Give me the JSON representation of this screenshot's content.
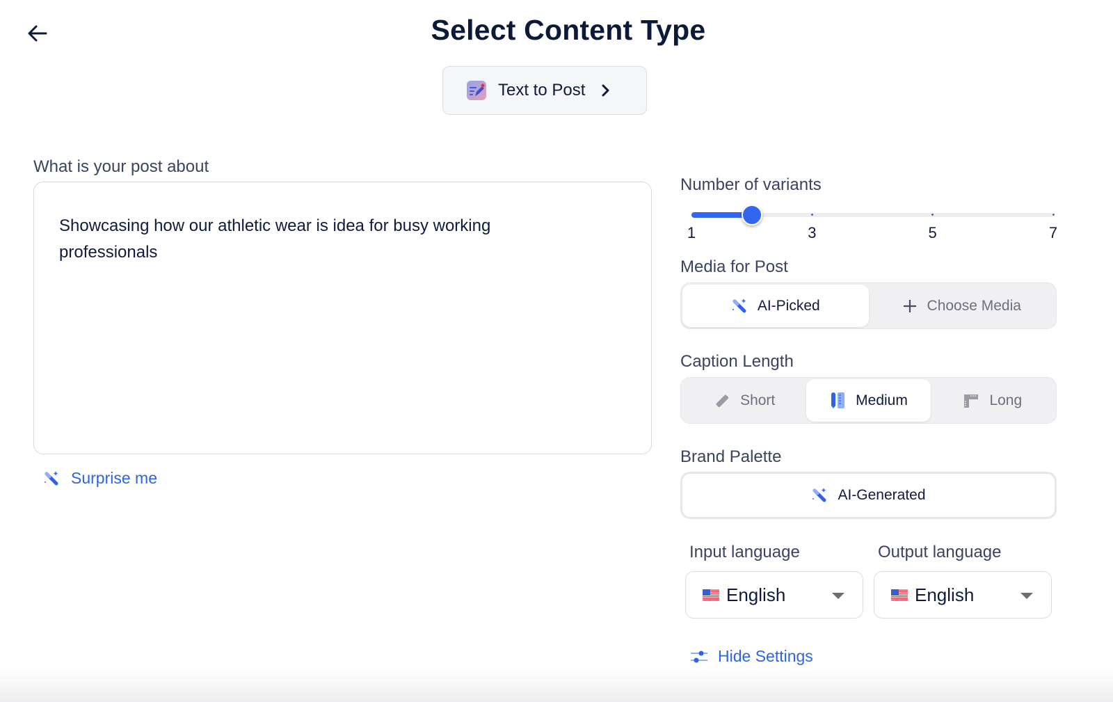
{
  "header": {
    "title": "Select Content Type",
    "back_icon": "arrow-left-icon"
  },
  "content_type": {
    "label": "Text to Post",
    "icon": "text-edit-icon",
    "chevron_icon": "chevron-right-icon"
  },
  "post": {
    "label": "What is your post about",
    "value": "Showcasing how our athletic wear is idea for busy working professionals",
    "surprise_label": "Surprise me",
    "surprise_icon": "magic-wand-icon"
  },
  "variants": {
    "label": "Number of variants",
    "min": 1,
    "max": 7,
    "value": 2,
    "tick_labels": [
      "1",
      "3",
      "5",
      "7"
    ],
    "tick_values": [
      1,
      3,
      5,
      7
    ]
  },
  "media": {
    "label": "Media for Post",
    "options": [
      {
        "label": "AI-Picked",
        "icon": "magic-wand-icon",
        "active": true
      },
      {
        "label": "Choose Media",
        "icon": "plus-icon",
        "active": false
      }
    ]
  },
  "caption_length": {
    "label": "Caption Length",
    "options": [
      {
        "label": "Short",
        "icon": "ruler-icon",
        "active": false
      },
      {
        "label": "Medium",
        "icon": "pen-ruler-icon",
        "active": true
      },
      {
        "label": "Long",
        "icon": "corner-ruler-icon",
        "active": false
      }
    ]
  },
  "brand_palette": {
    "label": "Brand Palette",
    "value": "AI-Generated",
    "icon": "magic-wand-icon"
  },
  "languages": {
    "input_label": "Input language",
    "input_value": "English",
    "output_label": "Output language",
    "output_value": "English",
    "flag": "us-flag-icon"
  },
  "settings_toggle": {
    "label": "Hide Settings",
    "icon": "sliders-icon"
  },
  "colors": {
    "accent": "#3366f0",
    "link": "#2d63e8",
    "title": "#0c1a3a"
  }
}
